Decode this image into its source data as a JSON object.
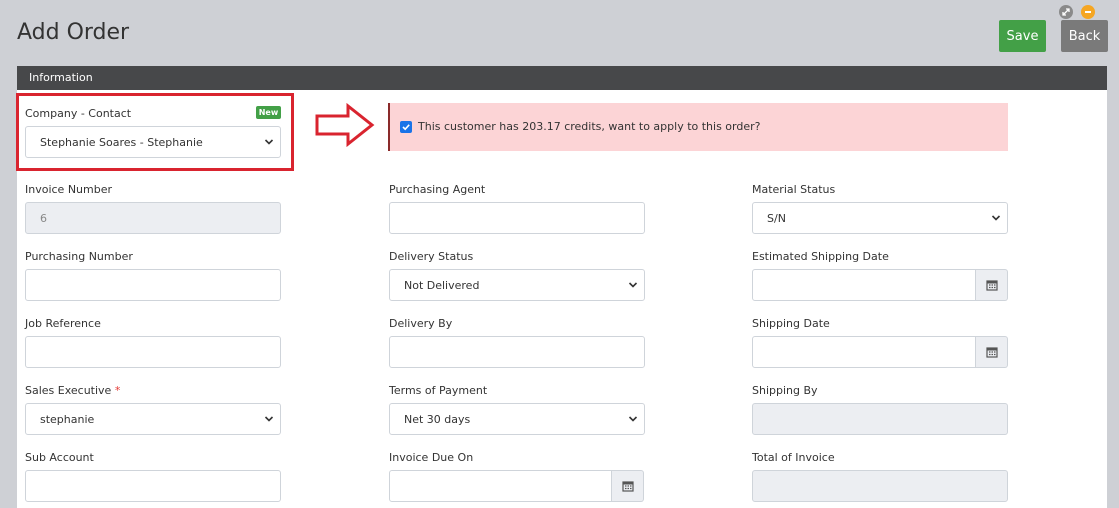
{
  "header": {
    "title": "Add Order",
    "save_label": "Save",
    "back_label": "Back"
  },
  "panel": {
    "title": "Information"
  },
  "company": {
    "label": "Company - Contact",
    "badge": "New",
    "value": "Stephanie Soares - Stephanie"
  },
  "alert": {
    "checked": true,
    "text": "This customer has 203.17 credits, want to apply to this order?"
  },
  "col1": {
    "invoice_number": {
      "label": "Invoice Number",
      "value": "6"
    },
    "purchasing_number": {
      "label": "Purchasing Number",
      "value": ""
    },
    "job_reference": {
      "label": "Job Reference",
      "value": ""
    },
    "sales_executive": {
      "label": "Sales Executive",
      "required_mark": "*",
      "value": "stephanie"
    },
    "sub_account": {
      "label": "Sub Account",
      "value": ""
    }
  },
  "col2": {
    "purchasing_agent": {
      "label": "Purchasing Agent",
      "value": ""
    },
    "delivery_status": {
      "label": "Delivery Status",
      "value": "Not Delivered"
    },
    "delivery_by": {
      "label": "Delivery By",
      "value": ""
    },
    "terms_of_payment": {
      "label": "Terms of Payment",
      "value": "Net 30 days"
    },
    "invoice_due_on": {
      "label": "Invoice Due On",
      "value": ""
    }
  },
  "col3": {
    "material_status": {
      "label": "Material Status",
      "value": "S/N"
    },
    "estimated_shipping_date": {
      "label": "Estimated Shipping Date",
      "value": ""
    },
    "shipping_date": {
      "label": "Shipping Date",
      "value": ""
    },
    "shipping_by": {
      "label": "Shipping By",
      "value": ""
    },
    "total_of_invoice": {
      "label": "Total of Invoice",
      "value": ""
    }
  },
  "colors": {
    "save": "#43a047",
    "back": "#7a7a7a",
    "highlight": "#d9242f",
    "alert_bg": "#fcd4d6",
    "panel_head": "#47484a"
  },
  "icons": [
    "expand-icon",
    "collapse-icon",
    "chevron-down-icon",
    "calendar-icon",
    "right-arrow-icon",
    "checkbox-checked-icon"
  ]
}
